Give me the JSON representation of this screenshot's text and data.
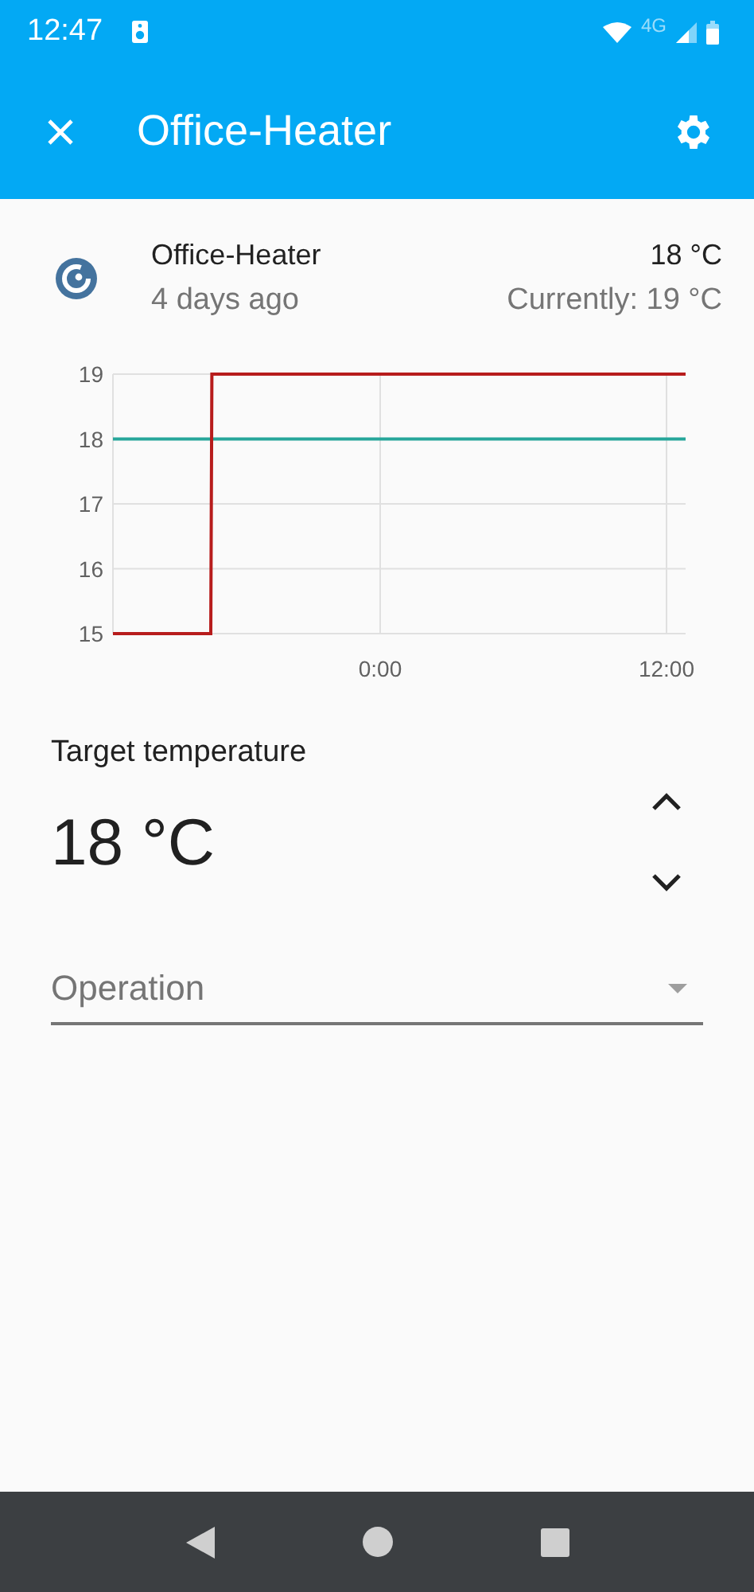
{
  "status_bar": {
    "time": "12:47",
    "network": "4G"
  },
  "app_bar": {
    "title": "Office-Heater"
  },
  "entity": {
    "name": "Office-Heater",
    "last_changed": "4 days ago",
    "target": "18 °C",
    "current": "Currently: 19 °C"
  },
  "chart_data": {
    "type": "line",
    "x": [
      -11.2,
      -7.1,
      -7.05,
      12.8
    ],
    "series": [
      {
        "color": "#b71c1c",
        "values": [
          15,
          15,
          19,
          19
        ]
      },
      {
        "color": "#26a69a",
        "values": [
          18,
          18,
          18,
          18
        ]
      }
    ],
    "xlim": [
      -11.2,
      12.8
    ],
    "ylim": [
      15,
      19
    ],
    "yticks": [
      15,
      16,
      17,
      18,
      19
    ],
    "grid": true,
    "xticks": [
      {
        "value": 0,
        "label": "0:00"
      },
      {
        "value": 12,
        "label": "12:00"
      }
    ]
  },
  "target_temperature": {
    "label": "Target temperature",
    "value": "18 °C"
  },
  "operation": {
    "placeholder": "Operation"
  }
}
